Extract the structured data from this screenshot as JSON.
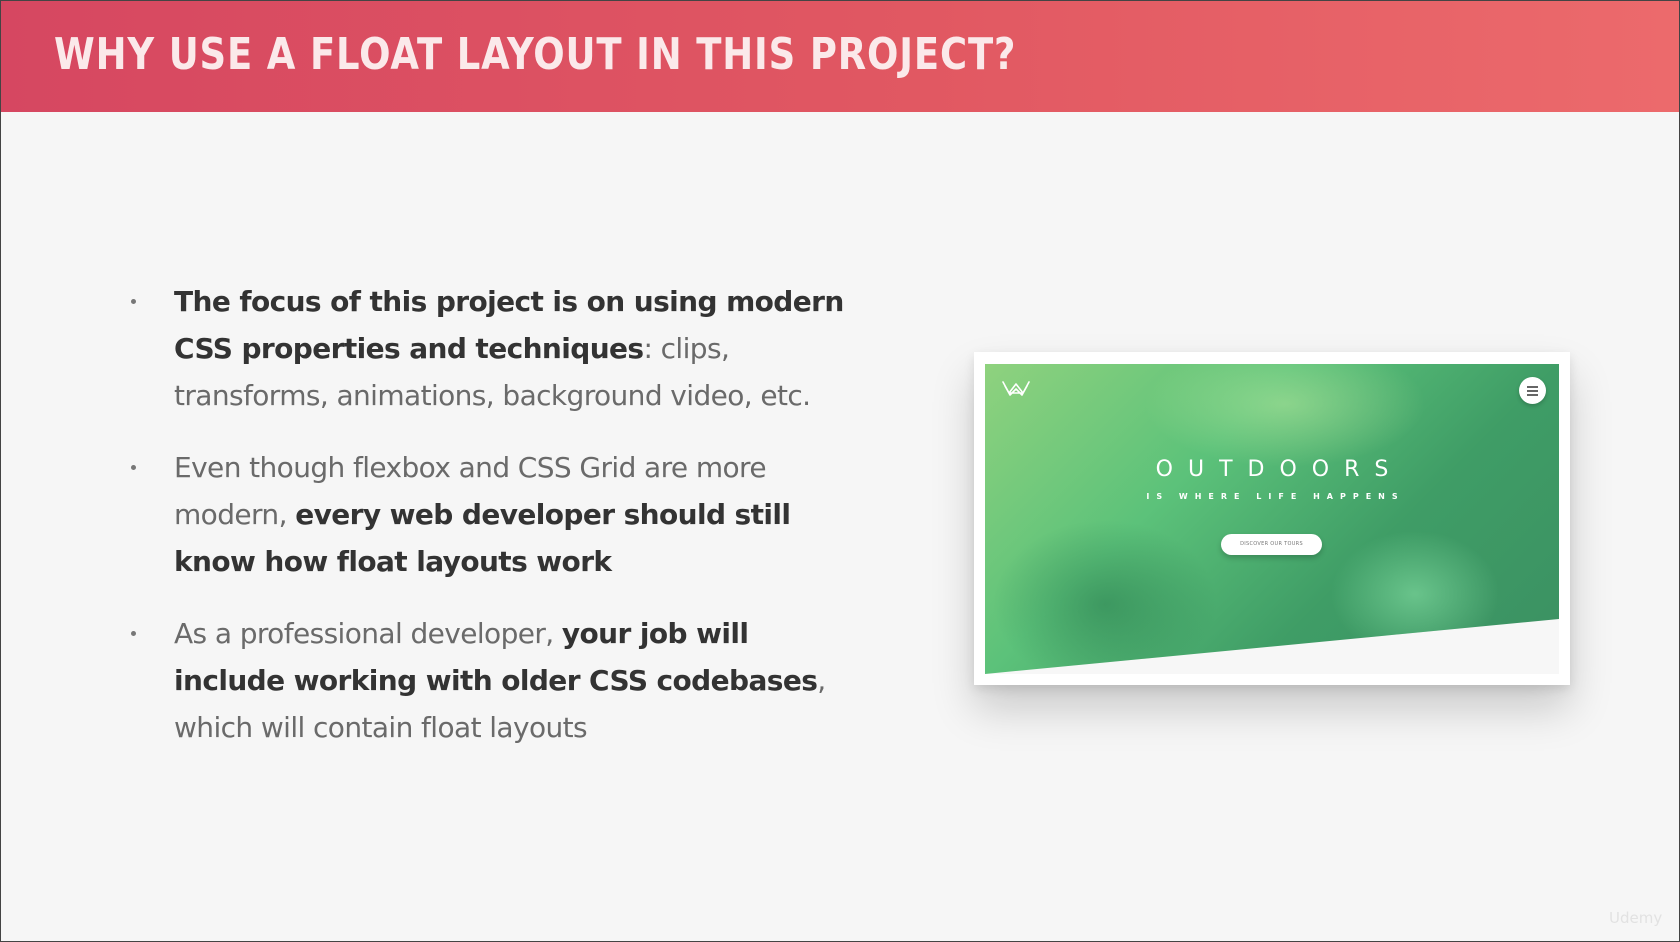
{
  "slide": {
    "title": "Why use a float layout in this project?",
    "header_gradient": [
      "#d64761",
      "#ec6a6c"
    ],
    "bullets": [
      {
        "segments": [
          {
            "text": "The focus of this project is on using modern CSS properties and techniques",
            "bold": true
          },
          {
            "text": ": clips, transforms, animations, background video, etc.",
            "bold": false
          }
        ]
      },
      {
        "segments": [
          {
            "text": "Even though flexbox and CSS Grid are more modern, ",
            "bold": false
          },
          {
            "text": "every web developer should still know how float layouts work",
            "bold": true
          }
        ]
      },
      {
        "segments": [
          {
            "text": "As a professional developer, ",
            "bold": false
          },
          {
            "text": "your job will include working with older CSS codebases",
            "bold": true
          },
          {
            "text": ", which will contain float layouts",
            "bold": false
          }
        ]
      }
    ]
  },
  "mockup": {
    "hero_title": "OUTDOORS",
    "hero_subtitle": "IS WHERE LIFE HAPPENS",
    "cta_label": "DISCOVER OUR TOURS",
    "logo_icon": "crown-icon",
    "menu_icon": "hamburger-menu-icon",
    "accent_color": "#55c57a"
  },
  "watermark": "Udemy"
}
